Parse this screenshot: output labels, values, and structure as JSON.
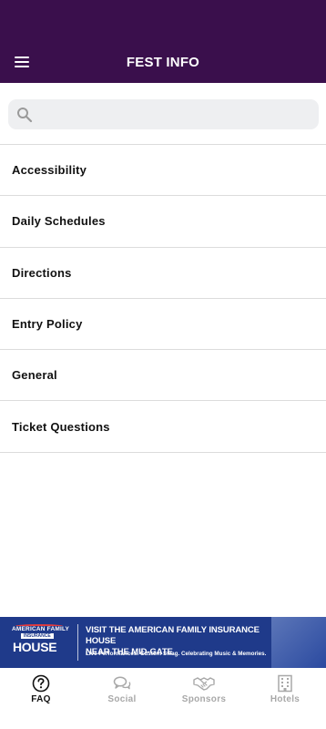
{
  "header": {
    "title": "FEST INFO"
  },
  "search": {
    "placeholder": "",
    "value": ""
  },
  "faq": {
    "items": [
      {
        "label": "Accessibility"
      },
      {
        "label": "Daily Schedules"
      },
      {
        "label": "Directions"
      },
      {
        "label": "Entry Policy"
      },
      {
        "label": "General"
      },
      {
        "label": "Ticket Questions"
      }
    ]
  },
  "ad": {
    "logo_line1": "AMERICAN FAMILY",
    "logo_line2": "INSURANCE",
    "logo_line3": "HOUSE",
    "headline_line1": "VISIT THE AMERICAN FAMILY INSURANCE HOUSE",
    "headline_line2": "NEAR THE MID-GATE",
    "subtext": "Live Performances. Custom Swag. Celebrating Music & Memories."
  },
  "tabs": [
    {
      "label": "FAQ",
      "icon": "question-circle-icon",
      "active": true
    },
    {
      "label": "Social",
      "icon": "chat-bubbles-icon",
      "active": false
    },
    {
      "label": "Sponsors",
      "icon": "handshake-icon",
      "active": false
    },
    {
      "label": "Hotels",
      "icon": "building-icon",
      "active": false
    }
  ],
  "colors": {
    "header_bg": "#3a0f4c",
    "ad_bg": "#1f3a8a",
    "active_tab": "#111111",
    "inactive_tab": "#a8a8a8"
  }
}
